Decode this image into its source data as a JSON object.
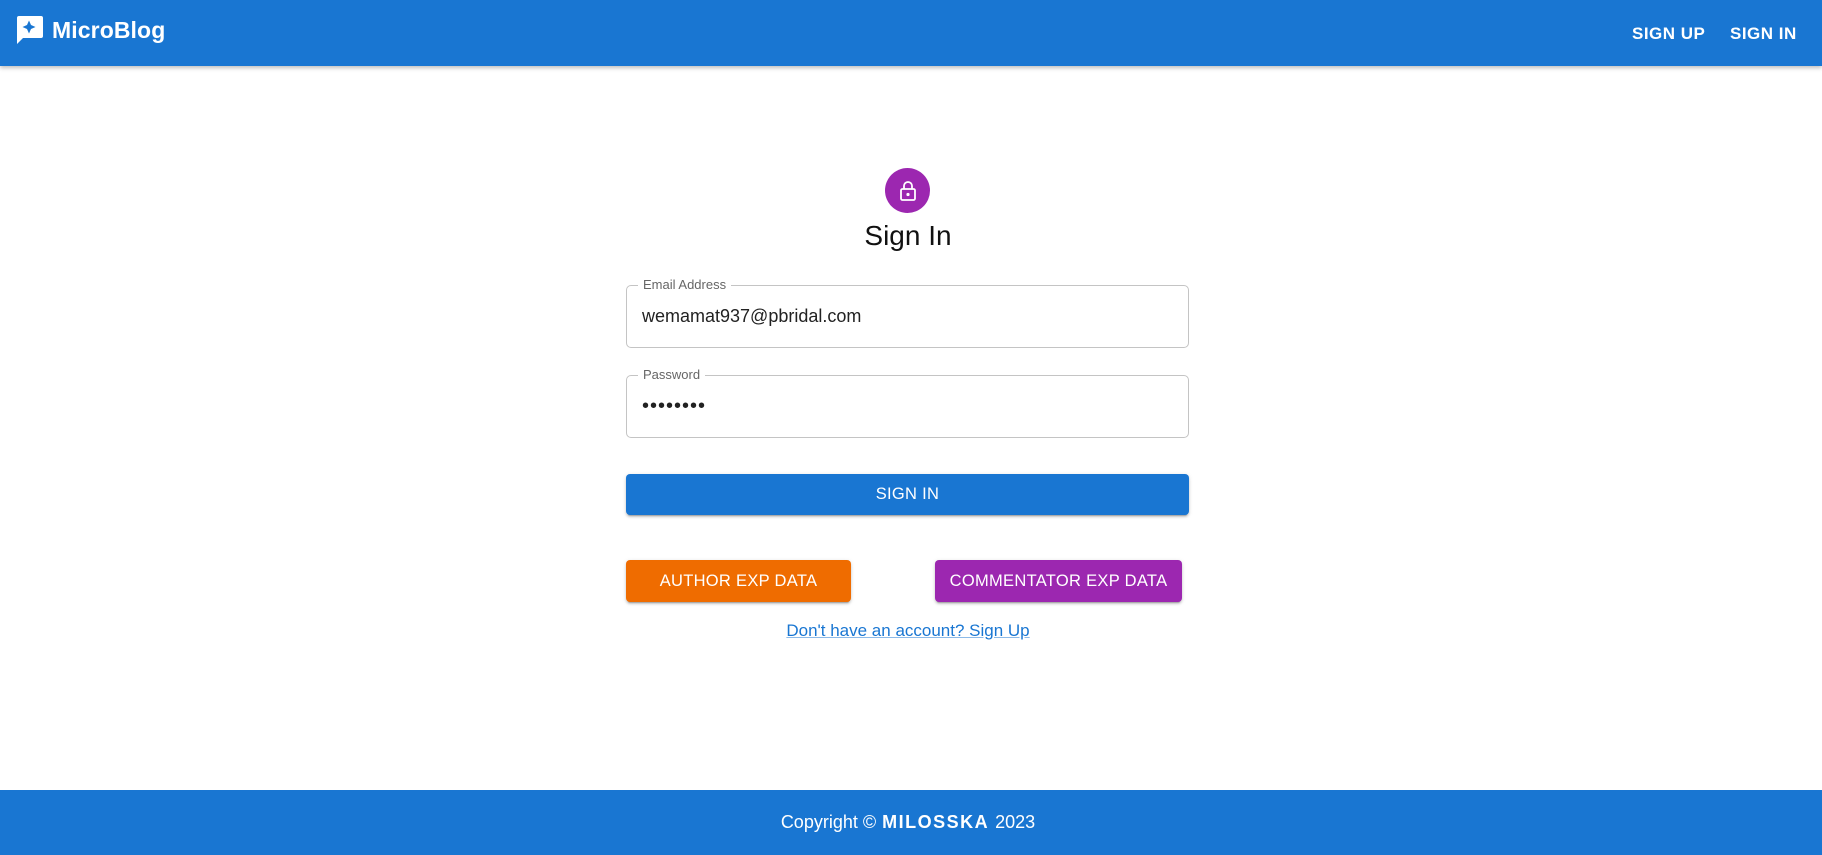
{
  "header": {
    "brand_title": "MicroBlog",
    "brand_icon": "chat-sparkle-icon",
    "nav": {
      "signup_label": "SIGN UP",
      "signin_label": "SIGN IN"
    }
  },
  "form": {
    "avatar_icon": "lock-icon",
    "title": "Sign In",
    "email": {
      "label": "Email Address",
      "value": "wemamat937@pbridal.com"
    },
    "password": {
      "label": "Password",
      "value": "••••••••"
    },
    "submit_label": "SIGN IN",
    "author_button_label": "AUTHOR EXP DATA",
    "commentator_button_label": "COMMENTATOR EXP DATA",
    "signup_link": "Don't have an account? Sign Up"
  },
  "footer": {
    "copyright_prefix": "Copyright ©",
    "brand": "MILOSSKA",
    "year": "2023"
  },
  "colors": {
    "primary": "#1976d2",
    "secondary": "#9c27b0",
    "warning": "#ef6c00"
  }
}
